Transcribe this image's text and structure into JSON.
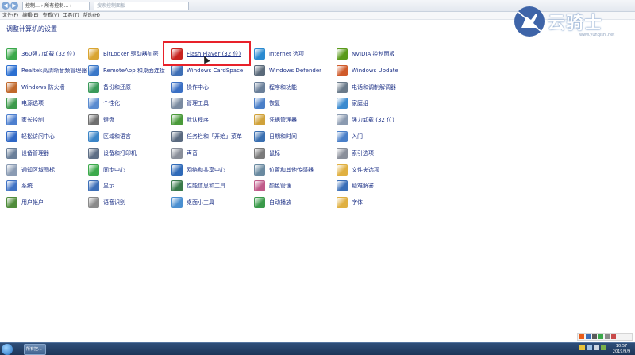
{
  "window": {
    "address": "控制… › 所有控制… ›",
    "search_placeholder": "搜索控制面板",
    "menu": [
      "文件(F)",
      "编辑(E)",
      "查看(V)",
      "工具(T)",
      "帮助(H)"
    ]
  },
  "logo": {
    "text": "云骑士",
    "url": "www.yunqishi.net"
  },
  "heading": "调整计算机的设置",
  "columns": [
    [
      {
        "label": "360强力卸载 (32 位)",
        "icon": "uninstall-icon",
        "color": "#3aa84a"
      },
      {
        "label": "Realtek高清晰音频管理器",
        "icon": "speaker-icon",
        "color": "#2b6fd1"
      },
      {
        "label": "Windows 防火墙",
        "icon": "firewall-icon",
        "color": "#c0682b"
      },
      {
        "label": "电源选项",
        "icon": "power-icon",
        "color": "#3d9a4b"
      },
      {
        "label": "家长控制",
        "icon": "parental-control-icon",
        "color": "#4d7fcf"
      },
      {
        "label": "轻松访问中心",
        "icon": "ease-of-access-icon",
        "color": "#2f67c5"
      },
      {
        "label": "设备管理器",
        "icon": "device-manager-icon",
        "color": "#6a7f99"
      },
      {
        "label": "通知区域图标",
        "icon": "notification-area-icon",
        "color": "#8a9bb3"
      },
      {
        "label": "系统",
        "icon": "system-icon",
        "color": "#3f72c4"
      },
      {
        "label": "用户帐户",
        "icon": "user-accounts-icon",
        "color": "#4f8c3a"
      }
    ],
    [
      {
        "label": "BitLocker 驱动器加密",
        "icon": "bitlocker-icon",
        "color": "#d9a531"
      },
      {
        "label": "RemoteApp 和桌面连接",
        "icon": "remote-desktop-icon",
        "color": "#3a78c9"
      },
      {
        "label": "备份和还原",
        "icon": "backup-icon",
        "color": "#3a9a5a"
      },
      {
        "label": "个性化",
        "icon": "personalization-icon",
        "color": "#5a8bd0"
      },
      {
        "label": "键盘",
        "icon": "keyboard-icon",
        "color": "#6f6f6f"
      },
      {
        "label": "区域和语言",
        "icon": "region-language-icon",
        "color": "#3b85c7"
      },
      {
        "label": "设备和打印机",
        "icon": "devices-printers-icon",
        "color": "#5e6f86"
      },
      {
        "label": "同步中心",
        "icon": "sync-center-icon",
        "color": "#3caa4b"
      },
      {
        "label": "显示",
        "icon": "display-icon",
        "color": "#3d6fb8"
      },
      {
        "label": "语音识别",
        "icon": "speech-recognition-icon",
        "color": "#8a8a8a"
      }
    ],
    [
      {
        "label": "Flash Player (32 位)",
        "icon": "flash-player-icon",
        "color": "#c8231f"
      },
      {
        "label": "Windows CardSpace",
        "icon": "cardspace-icon",
        "color": "#3f6fb5"
      },
      {
        "label": "操作中心",
        "icon": "action-center-icon",
        "color": "#3a6fc4"
      },
      {
        "label": "管理工具",
        "icon": "admin-tools-icon",
        "color": "#7a8aa0"
      },
      {
        "label": "默认程序",
        "icon": "default-programs-icon",
        "color": "#4a9a3a"
      },
      {
        "label": "任务栏和「开始」菜单",
        "icon": "taskbar-start-icon",
        "color": "#5a6a80"
      },
      {
        "label": "声音",
        "icon": "sound-icon",
        "color": "#8a8f9a"
      },
      {
        "label": "网络和共享中心",
        "icon": "network-sharing-icon",
        "color": "#2f6ab8"
      },
      {
        "label": "性能信息和工具",
        "icon": "performance-icon",
        "color": "#3a7a4a"
      },
      {
        "label": "桌面小工具",
        "icon": "gadgets-icon",
        "color": "#4a8fd0"
      }
    ],
    [
      {
        "label": "Internet 选项",
        "icon": "internet-options-icon",
        "color": "#2a8ad0"
      },
      {
        "label": "Windows Defender",
        "icon": "defender-icon",
        "color": "#5a6a7a"
      },
      {
        "label": "程序和功能",
        "icon": "programs-features-icon",
        "color": "#6a7f99"
      },
      {
        "label": "恢复",
        "icon": "recovery-icon",
        "color": "#4a7fc8"
      },
      {
        "label": "凭据管理器",
        "icon": "credential-manager-icon",
        "color": "#d0a23a"
      },
      {
        "label": "日期和时间",
        "icon": "date-time-icon",
        "color": "#3a6fb0"
      },
      {
        "label": "鼠标",
        "icon": "mouse-icon",
        "color": "#7a7a7a"
      },
      {
        "label": "位置和其他传感器",
        "icon": "location-sensors-icon",
        "color": "#6a8aa0"
      },
      {
        "label": "颜色管理",
        "icon": "color-management-icon",
        "color": "#c05a8a"
      },
      {
        "label": "自动播放",
        "icon": "autoplay-icon",
        "color": "#3a9a4a"
      }
    ],
    [
      {
        "label": "NVIDIA 控制面板",
        "icon": "nvidia-icon",
        "color": "#5a9a1a"
      },
      {
        "label": "Windows Update",
        "icon": "windows-update-icon",
        "color": "#d05a2a"
      },
      {
        "label": "电话和调制解调器",
        "icon": "phone-modem-icon",
        "color": "#6a7a8a"
      },
      {
        "label": "家庭组",
        "icon": "homegroup-icon",
        "color": "#3a8ad0"
      },
      {
        "label": "强力卸载 (32 位)",
        "icon": "uninstall-tool-icon",
        "color": "#8a9ab0"
      },
      {
        "label": "入门",
        "icon": "getting-started-icon",
        "color": "#4a7fc8"
      },
      {
        "label": "索引选项",
        "icon": "indexing-options-icon",
        "color": "#8a8f9a"
      },
      {
        "label": "文件夹选项",
        "icon": "folder-options-icon",
        "color": "#e0b040"
      },
      {
        "label": "疑难解答",
        "icon": "troubleshooting-icon",
        "color": "#3a6fb8"
      },
      {
        "label": "字体",
        "icon": "fonts-icon",
        "color": "#e0b040"
      }
    ]
  ],
  "taskbar": {
    "task_label": "所有控...",
    "time": "10:57",
    "date": "2019/9/9"
  }
}
